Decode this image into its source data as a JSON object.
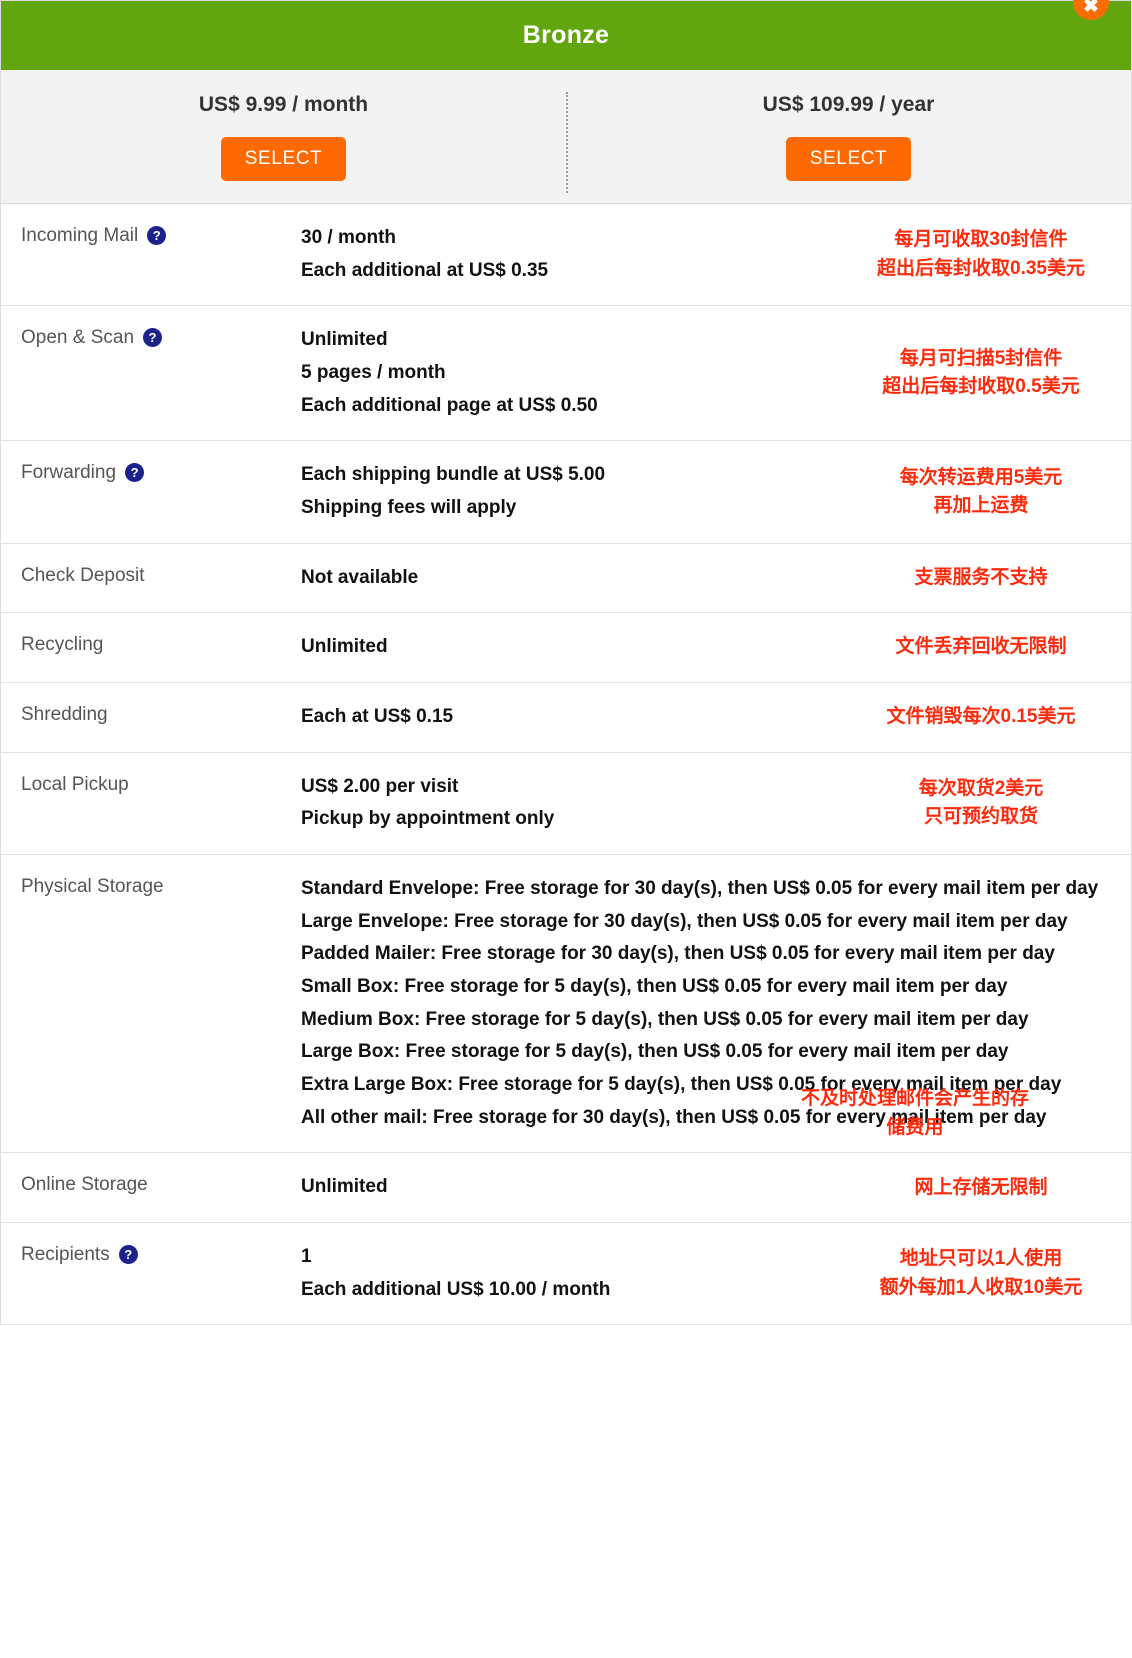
{
  "header": {
    "plan_title": "Bronze",
    "close_label": "✖",
    "close_icon": "close-icon",
    "brand_green": "#61a60e",
    "accent_orange": "#ff6a00",
    "annotation_red": "#fd2b0c",
    "help_icon_blue": "#1b228c"
  },
  "pricing": [
    {
      "price": "US$ 9.99 / month",
      "select_label": "SELECT"
    },
    {
      "price": "US$ 109.99 / year",
      "select_label": "SELECT"
    }
  ],
  "features": [
    {
      "name": "Incoming Mail",
      "help": true,
      "help_icon": "question-mark-icon",
      "values": [
        "30 / month",
        "Each additional at US$ 0.35"
      ],
      "notes": [
        "每月可收取30封信件",
        "超出后每封收取0.35美元"
      ]
    },
    {
      "name": "Open & Scan",
      "help": true,
      "help_icon": "question-mark-icon",
      "values": [
        "Unlimited",
        "5 pages / month",
        "Each additional page at US$ 0.50"
      ],
      "notes": [
        "每月可扫描5封信件",
        "超出后每封收取0.5美元"
      ]
    },
    {
      "name": "Forwarding",
      "help": true,
      "help_icon": "question-mark-icon",
      "values": [
        "Each shipping bundle at US$ 5.00",
        "Shipping fees will apply"
      ],
      "notes": [
        "每次转运费用5美元",
        "再加上运费"
      ]
    },
    {
      "name": "Check Deposit",
      "help": false,
      "values": [
        "Not available"
      ],
      "notes": [
        "支票服务不支持"
      ]
    },
    {
      "name": "Recycling",
      "help": false,
      "values": [
        "Unlimited"
      ],
      "notes": [
        "文件丢弃回收无限制"
      ]
    },
    {
      "name": "Shredding",
      "help": false,
      "values": [
        "Each at US$ 0.15"
      ],
      "notes": [
        "文件销毁每次0.15美元"
      ]
    },
    {
      "name": "Local Pickup",
      "help": false,
      "values": [
        "US$ 2.00 per visit",
        "Pickup by appointment only"
      ],
      "notes": [
        "每次取货2美元",
        "只可预约取货"
      ]
    },
    {
      "name": "Physical Storage",
      "help": false,
      "wide": true,
      "values": [
        "Standard Envelope: Free storage for 30 day(s), then US$ 0.05 for every mail item per day",
        "Large Envelope: Free storage for 30 day(s), then US$ 0.05 for every mail item per day",
        "Padded Mailer: Free storage for 30 day(s), then US$ 0.05 for every mail item per day",
        "Small Box: Free storage for 5 day(s), then US$ 0.05 for every mail item per day",
        "Medium Box: Free storage for 5 day(s), then US$ 0.05 for every mail item per day",
        "Large Box: Free storage for 5 day(s), then US$ 0.05 for every mail item per day",
        "Extra Large Box: Free storage for 5 day(s), then US$ 0.05 for every mail item per day",
        "All other mail: Free storage for 30 day(s), then US$ 0.05 for every mail item per day"
      ],
      "notes": [
        "不及时处理邮件会产生的存",
        "储费用"
      ]
    },
    {
      "name": "Online Storage",
      "help": false,
      "values": [
        "Unlimited"
      ],
      "notes": [
        "网上存储无限制"
      ]
    },
    {
      "name": "Recipients",
      "help": true,
      "help_icon": "question-mark-icon",
      "values": [
        "1",
        "Each additional US$ 10.00 / month"
      ],
      "notes": [
        "地址只可以1人使用",
        "额外每加1人收取10美元"
      ]
    }
  ]
}
